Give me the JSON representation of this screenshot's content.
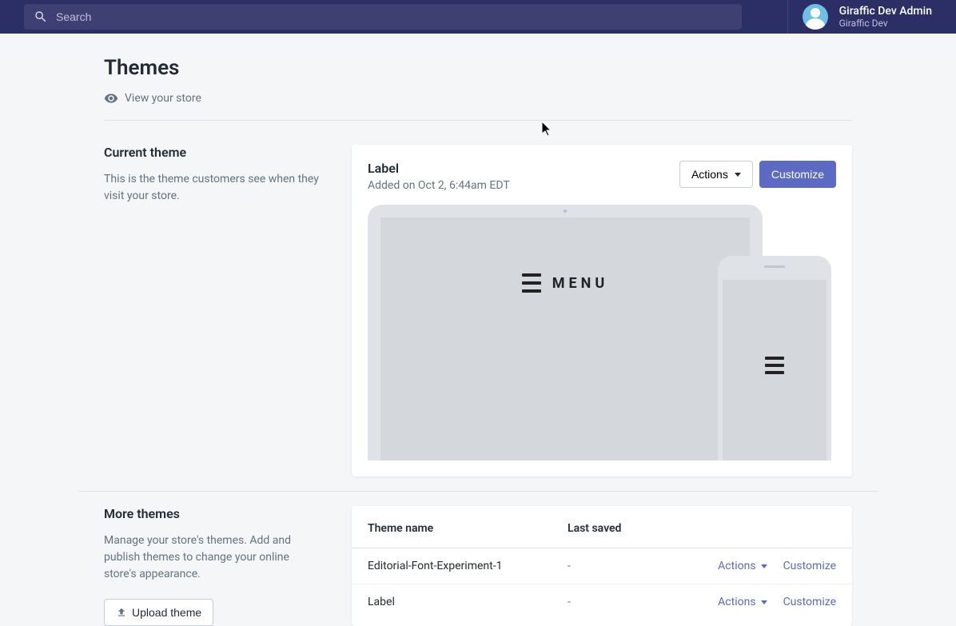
{
  "header": {
    "search_placeholder": "Search",
    "user_name": "Giraffic Dev Admin",
    "user_sub": "Giraffic Dev"
  },
  "page": {
    "title": "Themes",
    "view_store_label": "View your store"
  },
  "current": {
    "section_title": "Current theme",
    "section_desc": "This is the theme customers see when they visit your store.",
    "theme_name": "Label",
    "theme_added": "Added on Oct 2, 6:44am EDT",
    "actions_label": "Actions",
    "customize_label": "Customize",
    "preview_menu_text": "MENU"
  },
  "more": {
    "section_title": "More themes",
    "section_desc": "Manage your store's themes. Add and publish themes to change your online store's appearance.",
    "upload_label": "Upload theme",
    "table": {
      "col_name": "Theme name",
      "col_saved": "Last saved"
    },
    "rows": [
      {
        "name": "Editorial-Font-Experiment-1",
        "saved": "-",
        "actions": "Actions",
        "customize": "Customize"
      },
      {
        "name": "Label",
        "saved": "-",
        "actions": "Actions",
        "customize": "Customize"
      }
    ]
  }
}
